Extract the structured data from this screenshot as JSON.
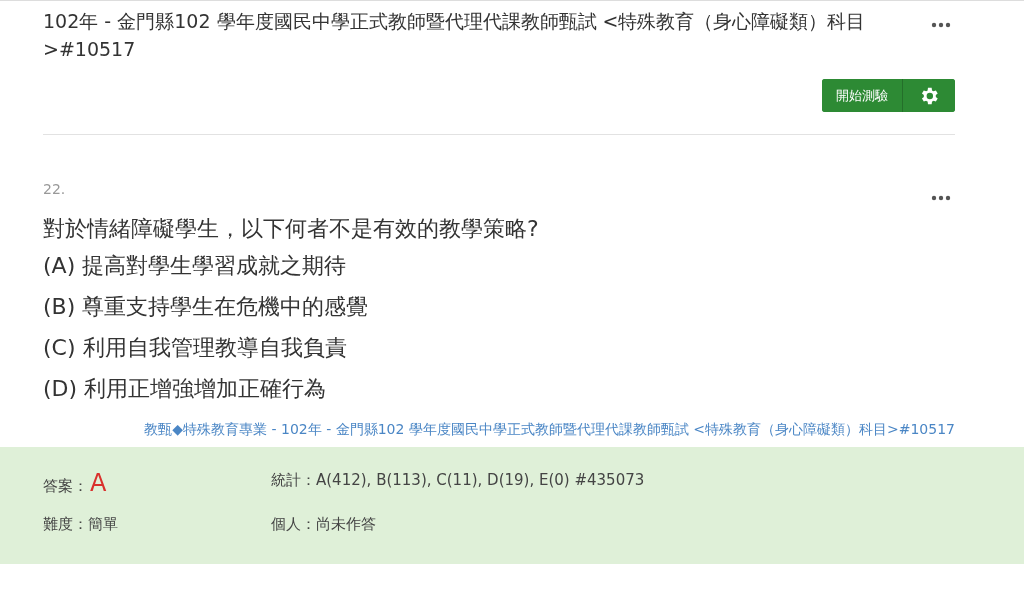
{
  "exam_card": {
    "title": "102年 - 金門縣102 學年度國民中學正式教師暨代理代課教師甄試 <特殊教育（身心障礙類）科目>#10517",
    "start_button": "開始測驗"
  },
  "question": {
    "number": "22.",
    "text": "對於情緒障礙學生，以下何者不是有效的教學策略?",
    "options": [
      {
        "text": "(A) 提高對學生學習成就之期待"
      },
      {
        "text": "(B) 尊重支持學生在危機中的感覺"
      },
      {
        "text": "(C) 利用自我管理教導自我負責"
      },
      {
        "text": "(D) 利用正增強增加正確行為"
      }
    ],
    "source_link": "教甄◆特殊教育專業 - 102年 - 金門縣102 學年度國民中學正式教師暨代理代課教師甄試 <特殊教育（身心障礙類）科目>#10517"
  },
  "answer_panel": {
    "answer_label": "答案：",
    "answer": "A",
    "stats": "統計：A(412), B(113), C(11), D(19), E(0) #435073",
    "difficulty": "難度：簡單",
    "personal": "個人：尚未作答"
  }
}
